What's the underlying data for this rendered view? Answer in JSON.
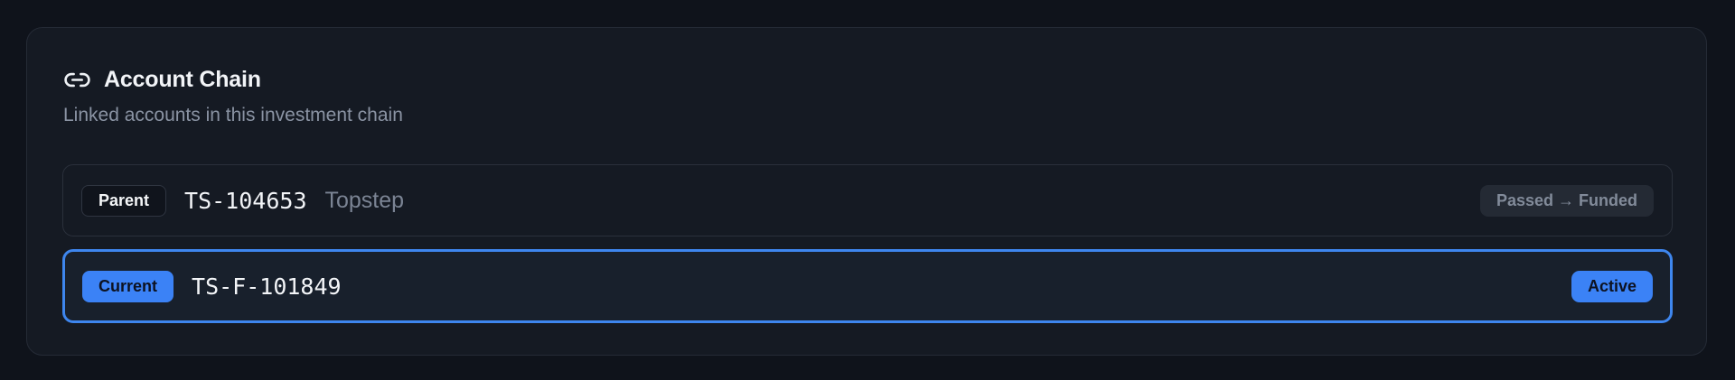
{
  "header": {
    "title": "Account Chain",
    "subtitle": "Linked accounts in this investment chain",
    "icon": "link-icon"
  },
  "accounts": [
    {
      "role": "Parent",
      "account_id": "TS-104653",
      "firm": "Topstep",
      "status": "Passed → Funded"
    },
    {
      "role": "Current",
      "account_id": "TS-F-101849",
      "firm": "",
      "status": "Active"
    }
  ],
  "colors": {
    "accent": "#3b82f6",
    "background": "#0f131b",
    "card": "#151a23",
    "muted_text": "#8a93a3"
  }
}
